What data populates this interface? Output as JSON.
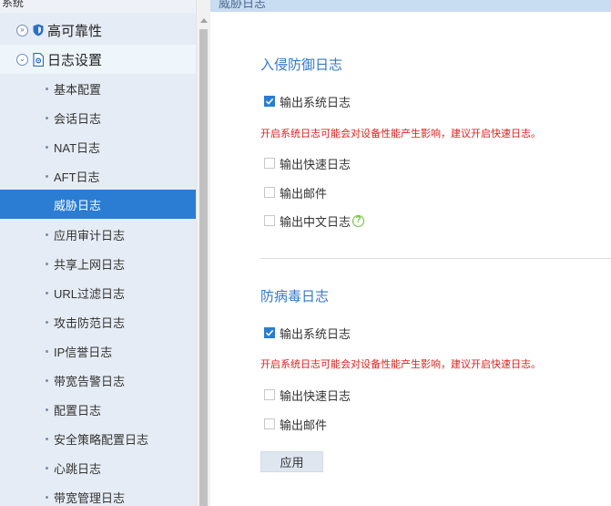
{
  "sidebar": {
    "top_fragment": "系统",
    "groups": [
      {
        "label": "高可靠性",
        "icon": "shield-icon",
        "expanded": false
      },
      {
        "label": "日志设置",
        "icon": "log-settings-icon",
        "expanded": true
      }
    ],
    "items": [
      {
        "label": "基本配置"
      },
      {
        "label": "会话日志"
      },
      {
        "label": "NAT日志"
      },
      {
        "label": "AFT日志"
      },
      {
        "label": "威胁日志",
        "active": true
      },
      {
        "label": "应用审计日志"
      },
      {
        "label": "共享上网日志"
      },
      {
        "label": "URL过滤日志"
      },
      {
        "label": "攻击防范日志"
      },
      {
        "label": "IP信誉日志"
      },
      {
        "label": "带宽告警日志"
      },
      {
        "label": "配置日志"
      },
      {
        "label": "安全策略配置日志"
      },
      {
        "label": "心跳日志"
      },
      {
        "label": "带宽管理日志"
      }
    ]
  },
  "main": {
    "title": "威胁日志",
    "intrusion": {
      "title": "入侵防御日志",
      "output_system_log": "输出系统日志",
      "warning": "开启系统日志可能会对设备性能产生影响，建议开启快速日志。",
      "output_fast_log": "输出快速日志",
      "output_email": "输出邮件",
      "output_chinese_log": "输出中文日志"
    },
    "antivirus": {
      "title": "防病毒日志",
      "output_system_log": "输出系统日志",
      "warning": "开启系统日志可能会对设备性能产生影响，建议开启快速日志。",
      "output_fast_log": "输出快速日志",
      "output_email": "输出邮件"
    },
    "apply_label": "应用"
  },
  "colors": {
    "accent": "#2b7cd3",
    "section_title": "#3477c9",
    "warning": "#e02020",
    "help": "#6cbf3a",
    "sidebar_bg": "#e6ecf5"
  }
}
